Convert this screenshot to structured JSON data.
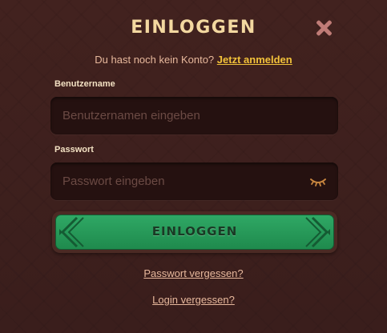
{
  "dialog": {
    "title": "EINLOGGEN",
    "signup_prompt": "Du hast noch kein Konto?",
    "signup_link": "Jetzt anmelden"
  },
  "username": {
    "label": "Benutzername",
    "value": "",
    "placeholder": "Benutzernamen eingeben"
  },
  "password": {
    "label": "Passwort",
    "value": "",
    "placeholder": "Passwort eingeben",
    "toggle_icon": "eye-closed-icon"
  },
  "login_button": {
    "label": "EINLOGGEN"
  },
  "links": {
    "forgot_password": "Passwort vergessen?",
    "forgot_login": "Login vergessen?"
  },
  "icons": {
    "close": "close-icon"
  },
  "colors": {
    "background": "#3a1e1c",
    "title": "#f3d8a0",
    "accent_link": "#f2c23a",
    "button_green": "#2fa865",
    "field_bg": "#251110",
    "close_icon": "#c07c77"
  }
}
